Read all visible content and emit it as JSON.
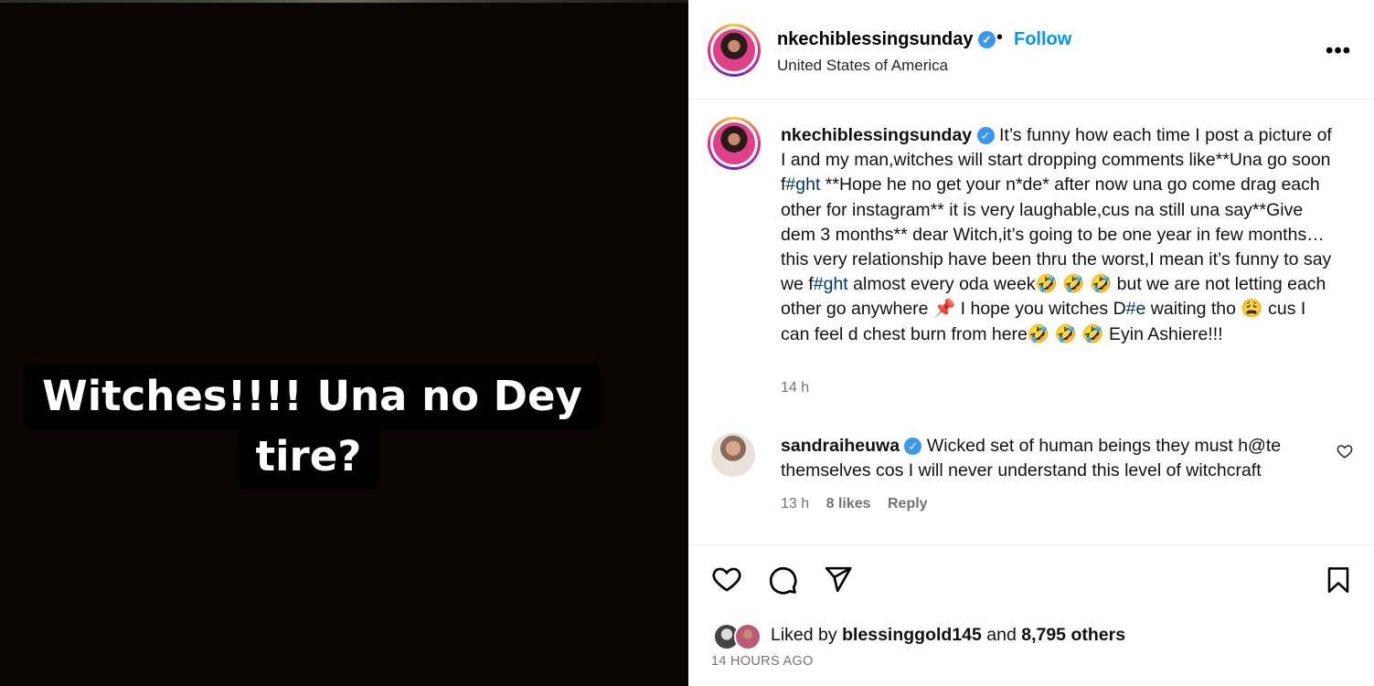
{
  "media": {
    "overlay_line1": "Witches!!!! Una no Dey",
    "overlay_line2": "tire?"
  },
  "header": {
    "username": "nkechiblessingsunday",
    "separator": "•",
    "follow_label": "Follow",
    "location": "United States of America",
    "more": "•••"
  },
  "caption": {
    "username": "nkechiblessingsunday",
    "seg1": " It’s funny how each time I post a picture of I and my man,witches will start dropping comments like**Una go soon f",
    "tag1": "#ght",
    "seg2": " **Hope he no get your n*de* after now una go come drag each other for instagram** it is very laughable,cus na still una say**Give dem 3 months** dear Witch,it’s going to be one year in few months…this very relationship have been thru the worst,I mean it’s funny to say we f",
    "tag2": "#ght",
    "seg3": " almost every oda week🤣 🤣 🤣  but we are not letting each other go anywhere 📌  I hope you witches D",
    "tag3": "#e",
    "seg4": " waiting tho 😩  cus I can feel d chest burn from here🤣 🤣 🤣  Eyin Ashiere!!!",
    "time": "14 h"
  },
  "comment": {
    "username": "sandraiheuwa",
    "text": " Wicked set of human beings they must h@te themselves cos I will never understand this level of witchcraft",
    "time": "13 h",
    "likes": "8 likes",
    "reply": "Reply"
  },
  "likes": {
    "prefix": "Liked by ",
    "user": "blessinggold145",
    "middle": " and ",
    "count": "8,795 others"
  },
  "posted": "14 HOURS AGO",
  "colors": {
    "accent": "#0095f6",
    "verified": "#3897f0",
    "hashtag": "#00376b",
    "muted": "#737373"
  }
}
